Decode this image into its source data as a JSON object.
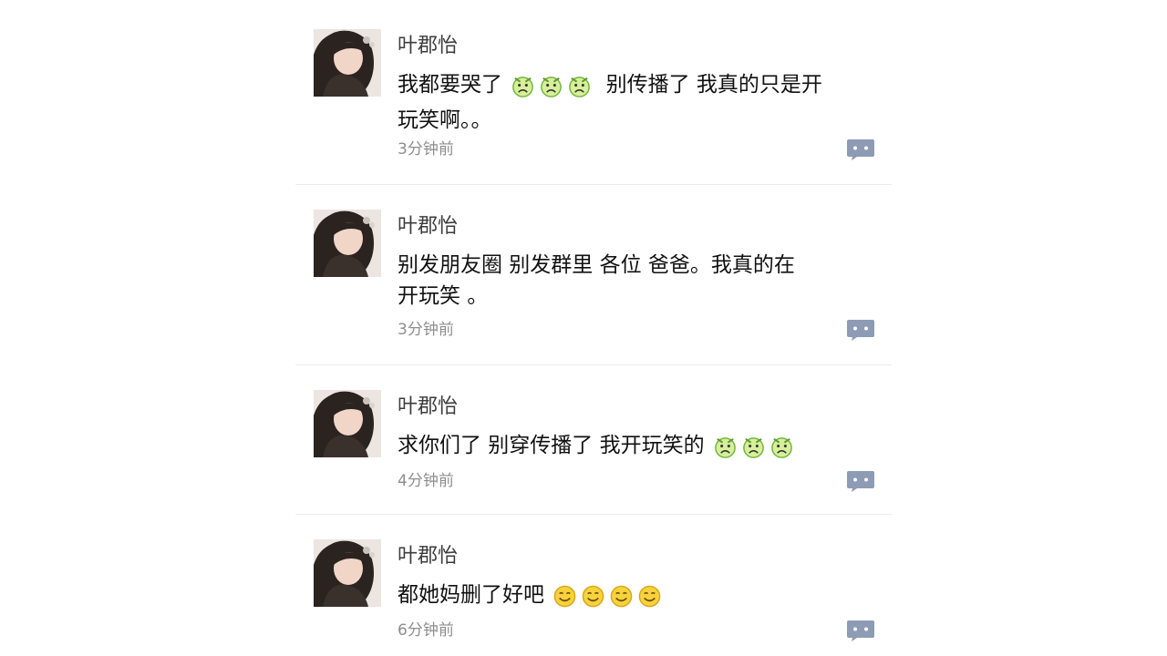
{
  "comments": [
    {
      "name": "叶郡怡",
      "text_lines": [
        "我都要哭了",
        " 别传播了 我真的只是开",
        "玩笑啊。。"
      ],
      "emoji_count": 3,
      "time": "3分钟前"
    },
    {
      "name": "叶郡怡",
      "text_lines": [
        "别发朋友圈 别发群里 各位 爸爸。我真的在",
        "开玩笑 。"
      ],
      "emoji_count": 0,
      "time": "3分钟前"
    },
    {
      "name": "叶郡怡",
      "text_lines": [
        "求你们了 别穿传播了 我开玩笑的"
      ],
      "emoji_count": 3,
      "time": "4分钟前"
    },
    {
      "name": "叶郡怡",
      "text_lines": [
        "都她妈删了好吧"
      ],
      "emoji_count": 4,
      "time": "6分钟前"
    }
  ],
  "icons": {
    "reply": "comment-bubble-icon",
    "emoji_a": "crying-face-emoji",
    "emoji_b": "smiling-face-emoji"
  },
  "colors": {
    "reply_icon": "#8e9bb5",
    "name": "#3c3c3c",
    "time": "#8e8e8e"
  }
}
